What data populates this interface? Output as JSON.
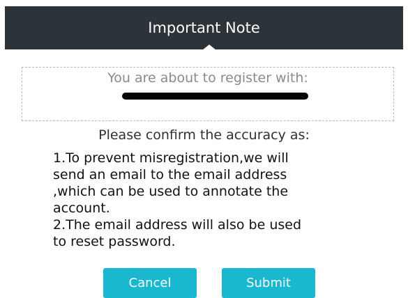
{
  "dialog": {
    "title": "Important Note"
  },
  "account": {
    "intro": "You are about to register with:"
  },
  "confirm": {
    "label": "Please confirm the accuracy as:",
    "lines": [
      "1.To prevent misregistration,we will",
      "send an email to the email address",
      ",which can be used to annotate the",
      "account.",
      "2.The email address will also be used",
      "to reset password."
    ]
  },
  "buttons": {
    "cancel": "Cancel",
    "submit": "Submit"
  },
  "colors": {
    "header_bg": "#2c3339",
    "button_bg": "#1ab7d1"
  }
}
